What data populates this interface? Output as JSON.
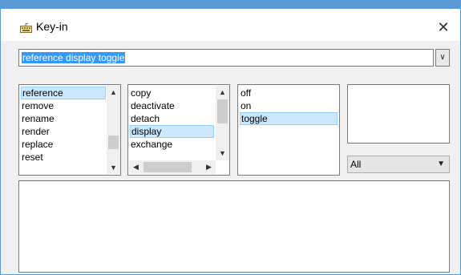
{
  "window": {
    "title": "Key-in",
    "icon": "keyboard-icon",
    "close_glyph": "✕"
  },
  "command": {
    "value": "reference display toggle",
    "dropdown_icon": "chevron-down-icon"
  },
  "list1": {
    "items": [
      "reference",
      "remove",
      "rename",
      "render",
      "replace",
      "reset"
    ],
    "selected_index": 0
  },
  "list2": {
    "items": [
      "copy",
      "deactivate",
      "detach",
      "display",
      "exchange"
    ],
    "selected_index": 3
  },
  "list3": {
    "items": [
      "off",
      "on",
      "toggle"
    ],
    "selected_index": 2
  },
  "list4": {
    "items": []
  },
  "filter": {
    "value": "All",
    "dropdown_icon": "chevron-down-icon"
  },
  "colors": {
    "accent": "#3399ff",
    "selection_bg": "#cce8ff",
    "frame": "#5b9bd5"
  }
}
